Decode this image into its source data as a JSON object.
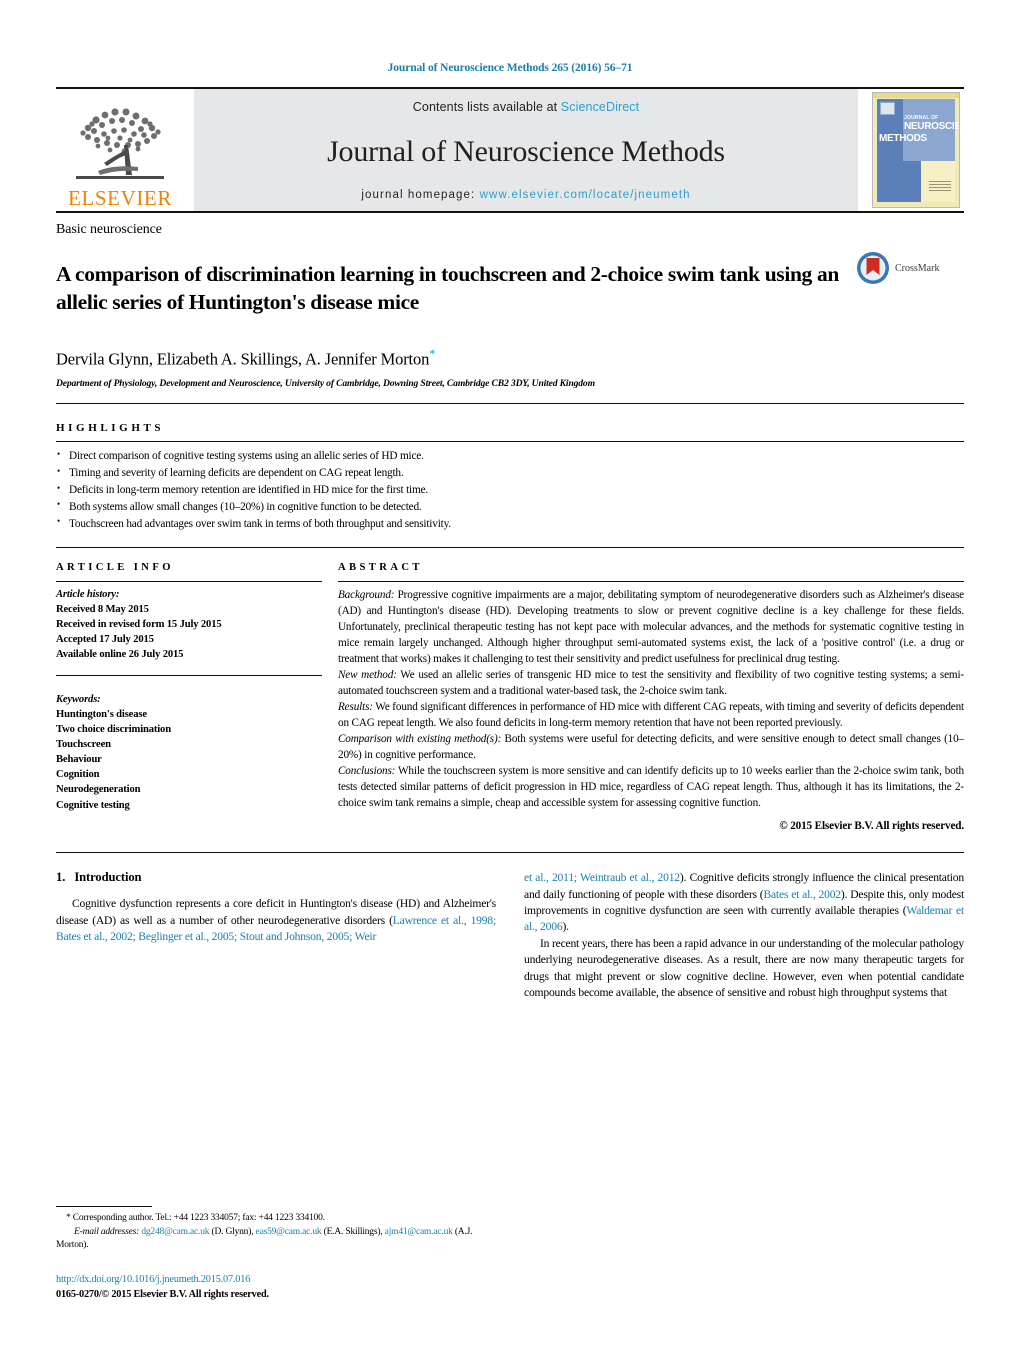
{
  "running_head": "Journal of Neuroscience Methods 265 (2016) 56–71",
  "masthead": {
    "contents_prefix": "Contents lists available at ",
    "sciencedirect": "ScienceDirect",
    "journal_title": "Journal of Neuroscience Methods",
    "homepage_prefix": "journal homepage: ",
    "homepage_url": "www.elsevier.com/locate/jneumeth",
    "publisher_logo_text": "ELSEVIER",
    "cover": {
      "line1": "JOURNAL OF",
      "line2": "NEUROSCIENCE",
      "line3": "METHODS"
    },
    "link_color": "#2a9fd0"
  },
  "article": {
    "category": "Basic neuroscience",
    "title": "A comparison of discrimination learning in touchscreen and 2-choice swim tank using an allelic series of Huntington's disease mice",
    "authors": "Dervila Glynn, Elizabeth A. Skillings, A. Jennifer Morton",
    "corresponding_marker": "*",
    "affiliation": "Department of Physiology, Development and Neuroscience, University of Cambridge, Downing Street, Cambridge CB2 3DY, United Kingdom",
    "crossmark_label": "CrossMark"
  },
  "highlights": {
    "heading": "HIGHLIGHTS",
    "items": [
      "Direct comparison of cognitive testing systems using an allelic series of HD mice.",
      "Timing and severity of learning deficits are dependent on CAG repeat length.",
      "Deficits in long-term memory retention are identified in HD mice for the first time.",
      "Both systems allow small changes (10–20%) in cognitive function to be detected.",
      "Touchscreen had advantages over swim tank in terms of both throughput and sensitivity."
    ]
  },
  "article_info": {
    "heading": "ARTICLE INFO",
    "history_label": "Article history:",
    "history": [
      "Received 8 May 2015",
      "Received in revised form 15 July 2015",
      "Accepted 17 July 2015",
      "Available online 26 July 2015"
    ],
    "keywords_label": "Keywords:",
    "keywords": [
      "Huntington's disease",
      "Two choice discrimination",
      "Touchscreen",
      "Behaviour",
      "Cognition",
      "Neurodegeneration",
      "Cognitive testing"
    ]
  },
  "abstract": {
    "heading": "ABSTRACT",
    "background_label": "Background:",
    "background_text": " Progressive cognitive impairments are a major, debilitating symptom of neurodegenerative disorders such as Alzheimer's disease (AD) and Huntington's disease (HD). Developing treatments to slow or prevent cognitive decline is a key challenge for these fields. Unfortunately, preclinical therapeutic testing has not kept pace with molecular advances, and the methods for systematic cognitive testing in mice remain largely unchanged. Although higher throughput semi-automated systems exist, the lack of a 'positive control' (i.e. a drug or treatment that works) makes it challenging to test their sensitivity and predict usefulness for preclinical drug testing.",
    "newmethod_label": "New method:",
    "newmethod_text": " We used an allelic series of transgenic HD mice to test the sensitivity and flexibility of two cognitive testing systems; a semi-automated touchscreen system and a traditional water-based task, the 2-choice swim tank.",
    "results_label": "Results:",
    "results_text": " We found significant differences in performance of HD mice with different CAG repeats, with timing and severity of deficits dependent on CAG repeat length. We also found deficits in long-term memory retention that have not been reported previously.",
    "comparison_label": "Comparison with existing method(s):",
    "comparison_text": " Both systems were useful for detecting deficits, and were sensitive enough to detect small changes (10–20%) in cognitive performance.",
    "conclusions_label": "Conclusions:",
    "conclusions_text": " While the touchscreen system is more sensitive and can identify deficits up to 10 weeks earlier than the 2-choice swim tank, both tests detected similar patterns of deficit progression in HD mice, regardless of CAG repeat length. Thus, although it has its limitations, the 2-choice swim tank remains a simple, cheap and accessible system for assessing cognitive function.",
    "copyright": "© 2015 Elsevier B.V. All rights reserved."
  },
  "introduction": {
    "section_number": "1.",
    "section_title": "Introduction",
    "left_para1_a": "Cognitive dysfunction represents a core deficit in Huntington's disease (HD) and Alzheimer's disease (AD) as well as a number of other neurodegenerative disorders (",
    "left_para1_refs": "Lawrence et al., 1998; Bates et al., 2002; Beglinger et al., 2005; Stout and Johnson, 2005; Weir",
    "right_refs_cont": "et al., 2011; Weintraub et al., 2012",
    "right_para1_a": "). Cognitive deficits strongly influence the clinical presentation and daily functioning of people with these disorders (",
    "right_ref2": "Bates et al., 2002",
    "right_para1_b": "). Despite this, only modest improvements in cognitive dysfunction are seen with currently available therapies (",
    "right_ref3": "Waldemar et al., 2006",
    "right_para1_c": ").",
    "right_para2": "In recent years, there has been a rapid advance in our understanding of the molecular pathology underlying neurodegenerative diseases. As a result, there are now many therapeutic targets for drugs that might prevent or slow cognitive decline. However, even when potential candidate compounds become available, the absence of sensitive and robust high throughput systems that"
  },
  "footnotes": {
    "corresponding": "* Corresponding author. Tel.: +44 1223 334057; fax: +44 1223 334100.",
    "email_label": "E-mail addresses:",
    "email1": "dg248@cam.ac.uk",
    "email1_name": " (D. Glynn), ",
    "email2": "eas59@cam.ac.uk",
    "email2_name": " (E.A. Skillings), ",
    "email3": "ajm41@cam.ac.uk",
    "email3_name": " (A.J. Morton).",
    "doi": "http://dx.doi.org/10.1016/j.jneumeth.2015.07.016",
    "issn": "0165-0270/© 2015 Elsevier B.V. All rights reserved."
  }
}
